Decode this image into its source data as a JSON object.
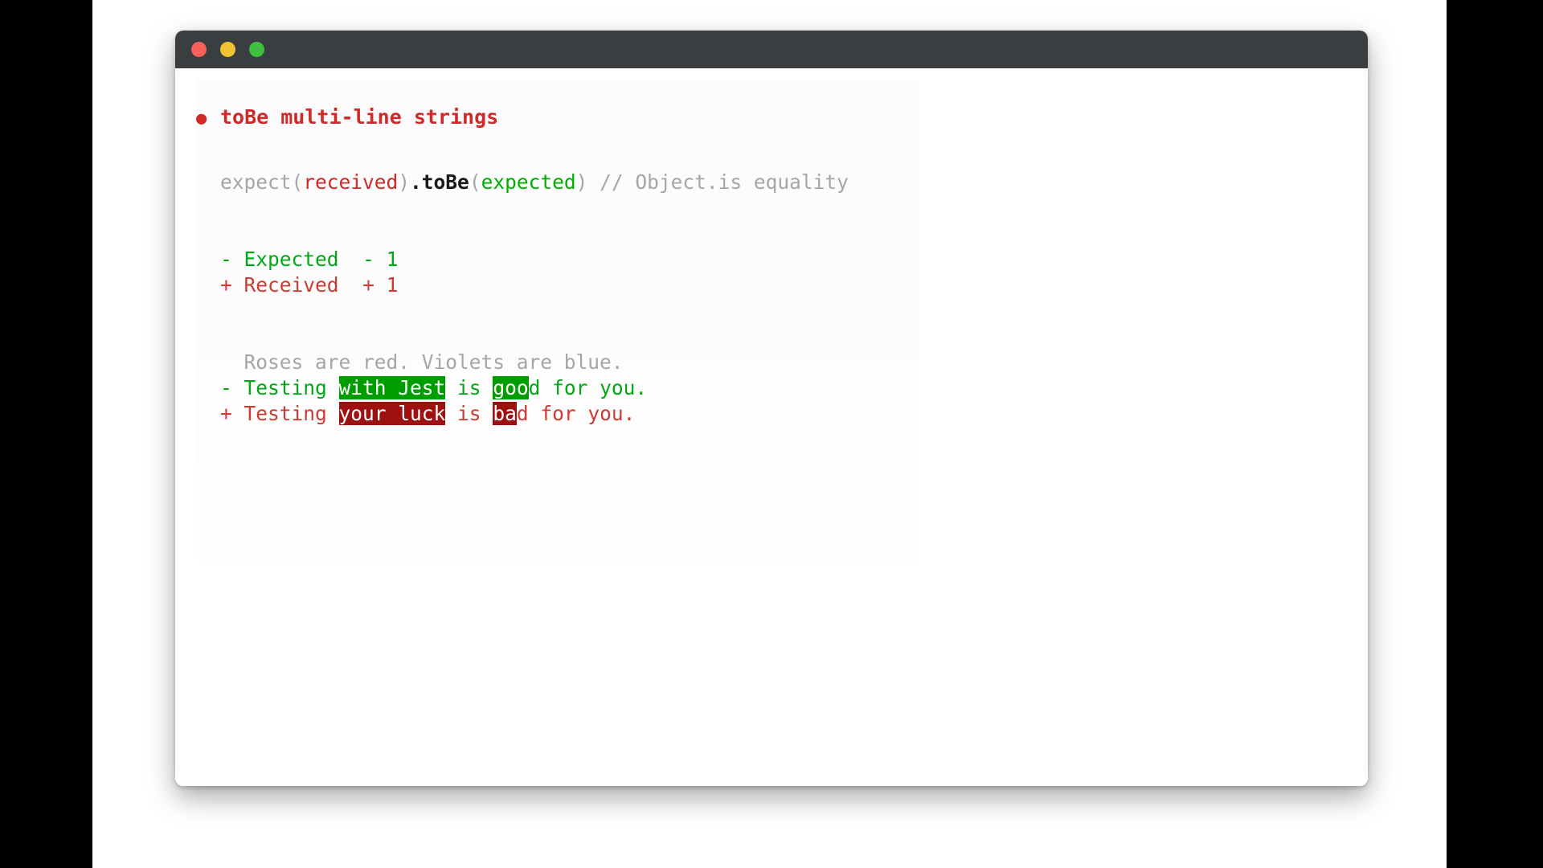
{
  "window": {
    "traffic_lights": [
      {
        "name": "close",
        "color": "#f8605a"
      },
      {
        "name": "minimize",
        "color": "#f2c332"
      },
      {
        "name": "maximize",
        "color": "#3ec03e"
      }
    ],
    "titlebar_color": "#3b3e41",
    "background_color": "#ffffff"
  },
  "terminal": {
    "heading": {
      "bullet": "●",
      "text": "toBe multi-line strings",
      "color": "#cf2a27"
    },
    "signature": {
      "expect": "expect(",
      "received": "received",
      "close_paren_1": ")",
      "dot_tobe": ".toBe",
      "open_paren_2": "(",
      "expected": "expected",
      "close_paren_2": ")",
      "comment": " // Object.is equality"
    },
    "legend": [
      {
        "marker": "-",
        "label": "Expected",
        "count_marker": "-",
        "count": "1",
        "kind": "expected"
      },
      {
        "marker": "+",
        "label": "Received",
        "count_marker": "+",
        "count": "1",
        "kind": "received"
      }
    ],
    "diff": [
      {
        "kind": "context",
        "marker": " ",
        "segments": [
          {
            "text": "Roses are red. Violets are blue.",
            "highlight": "none"
          }
        ]
      },
      {
        "kind": "expected",
        "marker": "-",
        "segments": [
          {
            "text": "Testing ",
            "highlight": "none"
          },
          {
            "text": "with Jest",
            "highlight": "green"
          },
          {
            "text": " is ",
            "highlight": "none"
          },
          {
            "text": "goo",
            "highlight": "green"
          },
          {
            "text": "d for you.",
            "highlight": "none"
          }
        ]
      },
      {
        "kind": "received",
        "marker": "+",
        "segments": [
          {
            "text": "Testing ",
            "highlight": "none"
          },
          {
            "text": "your luck",
            "highlight": "red"
          },
          {
            "text": " is ",
            "highlight": "none"
          },
          {
            "text": "ba",
            "highlight": "red"
          },
          {
            "text": "d for you.",
            "highlight": "none"
          }
        ]
      }
    ],
    "colors": {
      "expected_green": "#00a816",
      "received_red": "#cf3a33",
      "context_gray": "#a6a6a6",
      "highlight_green_bg": "#009d00",
      "highlight_red_bg": "#9d1111",
      "token_green": "#00b000",
      "token_red": "#cf2a27",
      "token_gray": "#a6a6a6",
      "token_black": "#1a1a1a"
    }
  }
}
